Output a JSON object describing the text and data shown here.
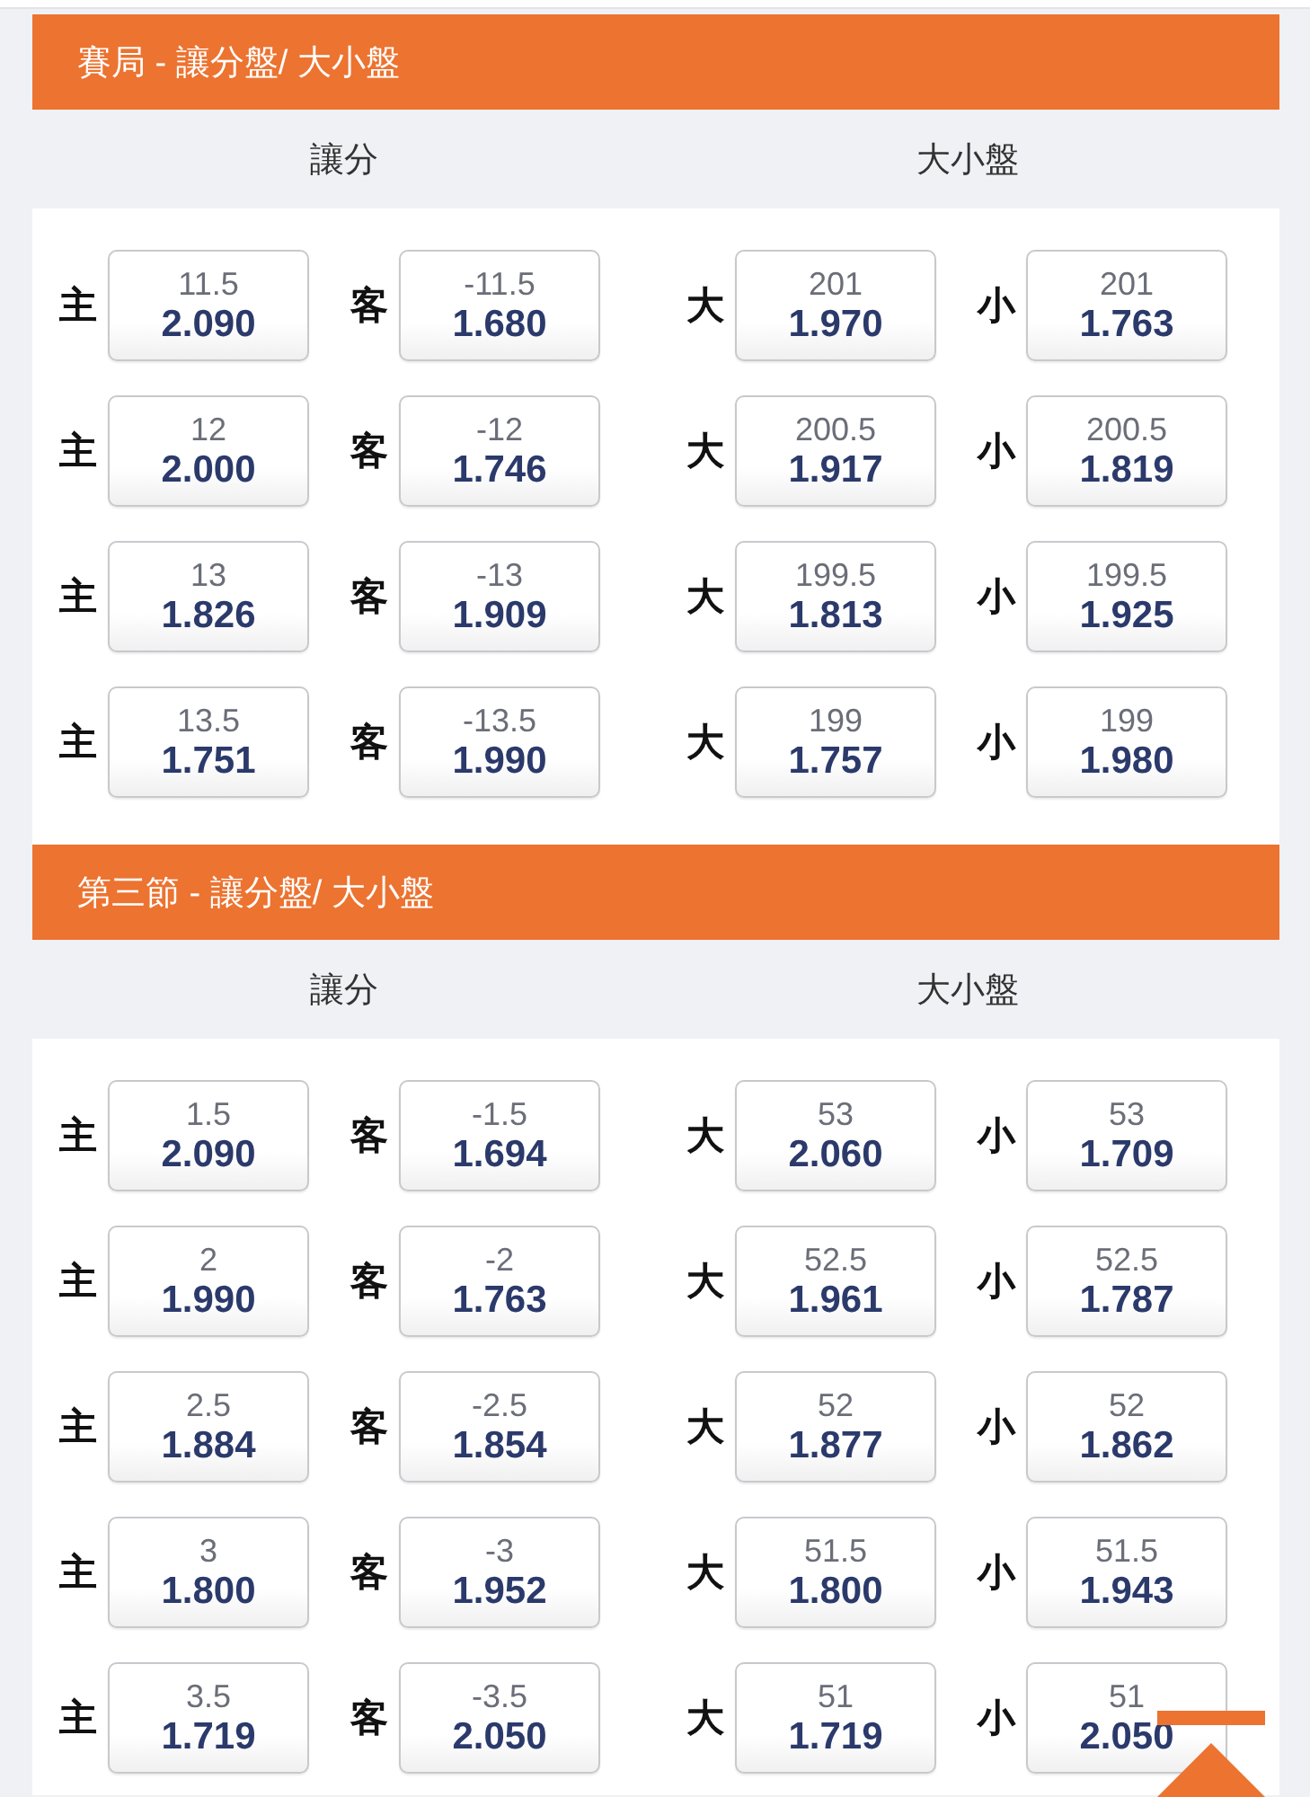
{
  "sections": [
    {
      "title": "賽局 - 讓分盤/ 大小盤",
      "column_headers": [
        "讓分",
        "大小盤"
      ],
      "rows": [
        {
          "cells": [
            {
              "side": "主",
              "line": "11.5",
              "odds": "2.090"
            },
            {
              "side": "客",
              "line": "-11.5",
              "odds": "1.680"
            },
            {
              "side": "大",
              "line": "201",
              "odds": "1.970"
            },
            {
              "side": "小",
              "line": "201",
              "odds": "1.763"
            }
          ]
        },
        {
          "cells": [
            {
              "side": "主",
              "line": "12",
              "odds": "2.000"
            },
            {
              "side": "客",
              "line": "-12",
              "odds": "1.746"
            },
            {
              "side": "大",
              "line": "200.5",
              "odds": "1.917"
            },
            {
              "side": "小",
              "line": "200.5",
              "odds": "1.819"
            }
          ]
        },
        {
          "cells": [
            {
              "side": "主",
              "line": "13",
              "odds": "1.826"
            },
            {
              "side": "客",
              "line": "-13",
              "odds": "1.909"
            },
            {
              "side": "大",
              "line": "199.5",
              "odds": "1.813"
            },
            {
              "side": "小",
              "line": "199.5",
              "odds": "1.925"
            }
          ]
        },
        {
          "cells": [
            {
              "side": "主",
              "line": "13.5",
              "odds": "1.751"
            },
            {
              "side": "客",
              "line": "-13.5",
              "odds": "1.990"
            },
            {
              "side": "大",
              "line": "199",
              "odds": "1.757"
            },
            {
              "side": "小",
              "line": "199",
              "odds": "1.980"
            }
          ]
        }
      ]
    },
    {
      "title": "第三節 - 讓分盤/ 大小盤",
      "column_headers": [
        "讓分",
        "大小盤"
      ],
      "rows": [
        {
          "cells": [
            {
              "side": "主",
              "line": "1.5",
              "odds": "2.090"
            },
            {
              "side": "客",
              "line": "-1.5",
              "odds": "1.694"
            },
            {
              "side": "大",
              "line": "53",
              "odds": "2.060"
            },
            {
              "side": "小",
              "line": "53",
              "odds": "1.709"
            }
          ]
        },
        {
          "cells": [
            {
              "side": "主",
              "line": "2",
              "odds": "1.990"
            },
            {
              "side": "客",
              "line": "-2",
              "odds": "1.763"
            },
            {
              "side": "大",
              "line": "52.5",
              "odds": "1.961"
            },
            {
              "side": "小",
              "line": "52.5",
              "odds": "1.787"
            }
          ]
        },
        {
          "cells": [
            {
              "side": "主",
              "line": "2.5",
              "odds": "1.884"
            },
            {
              "side": "客",
              "line": "-2.5",
              "odds": "1.854"
            },
            {
              "side": "大",
              "line": "52",
              "odds": "1.877"
            },
            {
              "side": "小",
              "line": "52",
              "odds": "1.862"
            }
          ]
        },
        {
          "cells": [
            {
              "side": "主",
              "line": "3",
              "odds": "1.800"
            },
            {
              "side": "客",
              "line": "-3",
              "odds": "1.952"
            },
            {
              "side": "大",
              "line": "51.5",
              "odds": "1.800"
            },
            {
              "side": "小",
              "line": "51.5",
              "odds": "1.943"
            }
          ]
        },
        {
          "cells": [
            {
              "side": "主",
              "line": "3.5",
              "odds": "1.719"
            },
            {
              "side": "客",
              "line": "-3.5",
              "odds": "2.050"
            },
            {
              "side": "大",
              "line": "51",
              "odds": "1.719"
            },
            {
              "side": "小",
              "line": "51",
              "odds": "2.050"
            }
          ]
        }
      ]
    }
  ]
}
